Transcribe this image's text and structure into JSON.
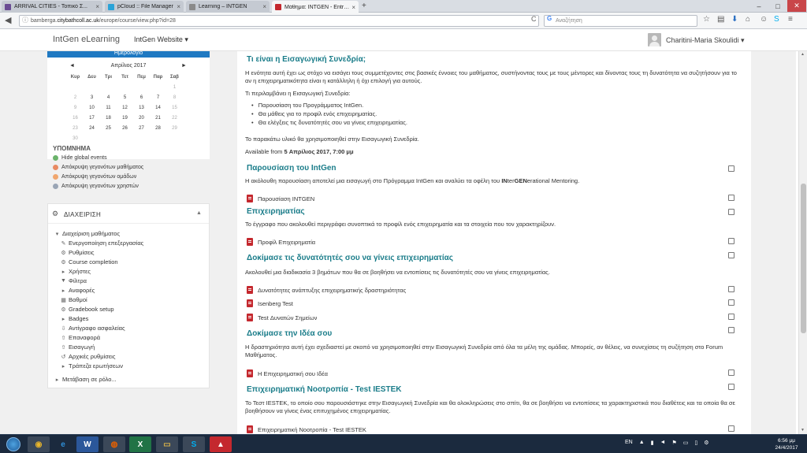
{
  "browser": {
    "tabs": [
      {
        "title": "ARRIVAL CITIES - Τοπικό Σ...",
        "favicon_color": "#6a4c93",
        "active": false
      },
      {
        "title": "pCloud :: File Manager",
        "favicon_color": "#2aa3d8",
        "active": false
      },
      {
        "title": "Learning – INTGEN",
        "favicon_color": "#8a8a8a",
        "active": false
      },
      {
        "title": "Μάθημα: INTGEN - Entrepr...",
        "favicon_color": "#c4282e",
        "active": true
      }
    ],
    "new_tab": "+",
    "url_prefix": "bamberga.",
    "url_domain": "citybathcoll.ac.uk",
    "url_suffix": "/europe/course/view.php?id=28",
    "reload": "C",
    "search_placeholder": "Αναζήτηση",
    "search_engine": "G",
    "window_controls": {
      "minimize": "–",
      "maximize": "□",
      "close": "✕"
    }
  },
  "site": {
    "brand": "IntGen eLearning",
    "menu": "IntGen Website",
    "menu_caret": "▾",
    "user": "Charitini-Maria Skoulidi",
    "user_caret": "▾"
  },
  "calendar": {
    "header": "Ημερολόγιο",
    "month": "Απρίλιος 2017",
    "prev": "◄",
    "next": "►",
    "weekdays": [
      "Κυρ",
      "Δευ",
      "Τρι",
      "Τετ",
      "Πεμ",
      "Παρ",
      "Σαβ"
    ],
    "weeks": [
      [
        "",
        "",
        "",
        "",
        "",
        "",
        "1"
      ],
      [
        "2",
        "3",
        "4",
        "5",
        "6",
        "7",
        "8"
      ],
      [
        "9",
        "10",
        "11",
        "12",
        "13",
        "14",
        "15"
      ],
      [
        "16",
        "17",
        "18",
        "19",
        "20",
        "21",
        "22"
      ],
      [
        "23",
        "24",
        "25",
        "26",
        "27",
        "28",
        "29"
      ],
      [
        "30",
        "",
        "",
        "",
        "",
        "",
        ""
      ]
    ]
  },
  "events": {
    "title": "ΥΠΟΜΝΗΜΑ",
    "items": [
      {
        "label": "Hide global events",
        "color": "#6bb36b"
      },
      {
        "label": "Απόκρυψη γεγονότων μαθήματος",
        "color": "#e88a62"
      },
      {
        "label": "Απόκρυψη γεγονότων ομάδων",
        "color": "#f0a66e"
      },
      {
        "label": "Απόκρυψη γεγονότων χρηστών",
        "color": "#9aa5b5"
      }
    ]
  },
  "admin": {
    "title": "ΔΙΑΧΕΙΡΙΣΗ",
    "collapse": "▲",
    "root": "Διαχείριση μαθήματος",
    "items": [
      {
        "label": "Ενεργοποίηση επεξεργασίας",
        "icon": "✎"
      },
      {
        "label": "Ρυθμίσεις",
        "icon": "⚙"
      },
      {
        "label": "Course completion",
        "icon": "⚙"
      },
      {
        "label": "Χρήστες",
        "icon": "▸"
      },
      {
        "label": "Φίλτρα",
        "icon": "▼"
      },
      {
        "label": "Αναφορές",
        "icon": "▸"
      },
      {
        "label": "Βαθμοί",
        "icon": "▦"
      },
      {
        "label": "Gradebook setup",
        "icon": "⚙"
      },
      {
        "label": "Badges",
        "icon": "▸"
      },
      {
        "label": "Αντίγραφο ασφαλείας",
        "icon": "⇩"
      },
      {
        "label": "Επαναφορά",
        "icon": "⇧"
      },
      {
        "label": "Εισαγωγή",
        "icon": "⇧"
      },
      {
        "label": "Αρχικές ρυθμίσεις",
        "icon": "↺"
      },
      {
        "label": "Τράπεζα ερωτήσεων",
        "icon": "▸"
      }
    ],
    "switch_role": "Μετάβαση σε ρόλο..."
  },
  "course": {
    "intro_title": "Τι είναι η Εισαγωγική Συνεδρία;",
    "intro_p1": "Η ενότητα αυτή έχει ως στόχο να εισάγει τους συμμετέχοντες στις βασικές έννοιες του μαθήματος, συστήνοντας τους με τους μέντορες και δίνοντας τους τη δυνατότητα να συζητήσουν για το αν η επιχειρηματικότητα είναι η κατάλληλη ή όχι επιλογή για αυτούς.",
    "intro_p2": "Τι περιλαμβάνει η Εισαγωγική Συνεδρία:",
    "intro_list": [
      "Παρουσίαση του Προγράμματος IntGen.",
      "Θα μάθεις για το προφίλ ενός επιχειρηματίας.",
      "Θα ελέγξεις τις δυνατότητές σου να γίνεις επιχειρηματίας."
    ],
    "intro_p3": "Το παρακάτω υλικό θα χρησιμοποιηθεί στην Εισαγωγική Συνεδρία.",
    "available_prefix": "Available from ",
    "available_date": "5 Απρίλιος 2017, 7:00 μμ",
    "sections": [
      {
        "title": "Παρουσίαση του IntGen",
        "desc_a": "Η ακόλουθη παρουσίαση αποτελεί μια εισαγωγή στο Πρόγραμμα IntGen και αναλύει τα οφέλη του ",
        "desc_b1": "IN",
        "desc_b2": "ter",
        "desc_b3": "GEN",
        "desc_c": "erational Mentoring.",
        "resources": [
          "Παρουσίαση INTGEN"
        ]
      },
      {
        "title": "Επιχειρηματίας",
        "desc": "Το έγγραφο που ακολουθεί περιγράφει συνοπτικά το προφίλ ενός επιχειρηματία και τα στοιχεία που τον χαρακτηρίζουν.",
        "resources": [
          "Προφίλ Επιχειρηματία"
        ]
      },
      {
        "title": "Δοκίμασε τις δυνατότητές σου να γίνεις επιχειρηματίας",
        "desc": "Ακολουθεί μια διαδικασία 3 βημάτων που θα σε βοηθήσει να εντοπίσεις τις δυνατότητές σου να γίνεις επιχειρηματίας.",
        "resources": [
          "Δυνατότητες ανάπτυξης επιχειρηματικής δραστηριότητας",
          "Isenberg Test",
          "Test Δυνατών Σημείων"
        ]
      },
      {
        "title": "Δοκίμασε την Ιδέα σου",
        "desc": "Η δραστηριότητα αυτή έχει σχεδιαστεί με σκοπό να χρησιμοποιηθεί στην Εισαγωγική Συνεδρία από όλα τα μέλη της ομάδας. Μπορείς, αν θέλεις, να συνεχίσεις τη συζήτηση στο Forum Μαθήματος.",
        "resources": [
          "Η Επιχειρηματική σου Ιδέα"
        ]
      },
      {
        "title": "Επιχειρηματική Νοοτροπία - Test IESTEK",
        "desc": "Το Τεστ IESTEK, το οποίο σου παρουσιάστηκε στην Εισαγωγική Συνεδρία και θα ολοκληρώσεις στο σπίτι, θα σε βοηθήσει να εντοπίσεις τα χαρακτηριστικά που διαθέτεις και τα οποία θα σε βοηθήσουν να γίνεις ένας επιτυχημένος επιχειρηματίας.",
        "resources": [
          "Επιχειρηματική Νοοτροπία - Test IESTEK"
        ]
      }
    ]
  },
  "taskbar": {
    "apps": [
      {
        "name": "chrome",
        "glyph": "◉",
        "color": "#e9b52b"
      },
      {
        "name": "explorer",
        "glyph": "e",
        "color": "#2f8fd8"
      },
      {
        "name": "word",
        "glyph": "W",
        "color": "#2b579a"
      },
      {
        "name": "firefox",
        "glyph": "◍",
        "color": "#e66000"
      },
      {
        "name": "excel",
        "glyph": "X",
        "color": "#217346"
      },
      {
        "name": "files",
        "glyph": "▭",
        "color": "#d9b34a"
      },
      {
        "name": "skype",
        "glyph": "S",
        "color": "#00aff0"
      },
      {
        "name": "acrobat",
        "glyph": "▲",
        "color": "#c4282e"
      }
    ],
    "lang": "EN",
    "time": "6:56 μμ",
    "date": "24/4/2017"
  }
}
